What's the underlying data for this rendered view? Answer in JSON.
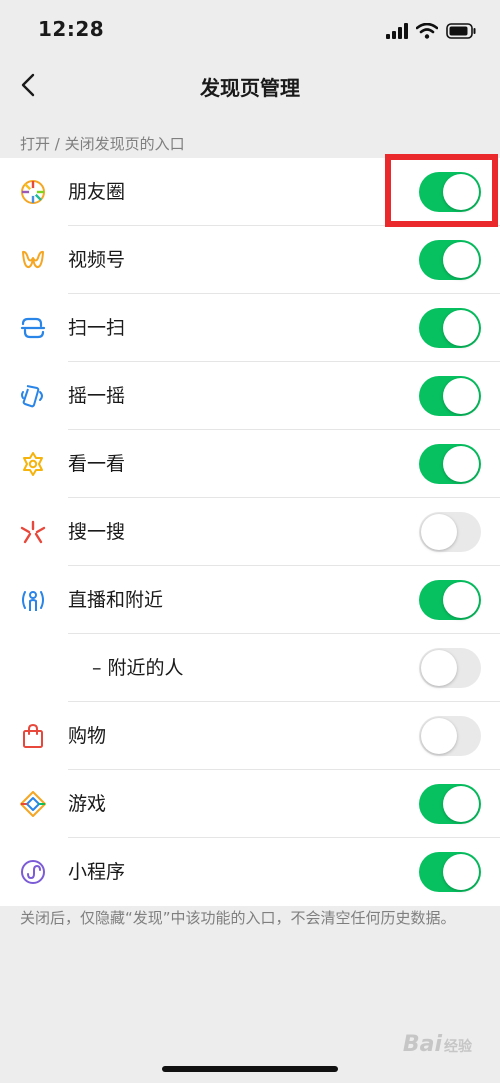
{
  "status_bar": {
    "time": "12:28"
  },
  "nav": {
    "title": "发现页管理"
  },
  "section_header": "打开 / 关闭发现页的入口",
  "items": [
    {
      "label": "朋友圈",
      "enabled": true,
      "icon": "moments-icon"
    },
    {
      "label": "视频号",
      "enabled": true,
      "icon": "channels-icon"
    },
    {
      "label": "扫一扫",
      "enabled": true,
      "icon": "scan-icon"
    },
    {
      "label": "摇一摇",
      "enabled": true,
      "icon": "shake-icon"
    },
    {
      "label": "看一看",
      "enabled": true,
      "icon": "top-stories-icon"
    },
    {
      "label": "搜一搜",
      "enabled": false,
      "icon": "search-icon"
    },
    {
      "label": "直播和附近",
      "enabled": true,
      "icon": "live-nearby-icon"
    },
    {
      "label": "– 附近的人",
      "enabled": false,
      "icon": ""
    },
    {
      "label": "购物",
      "enabled": false,
      "icon": "shopping-bag-icon"
    },
    {
      "label": "游戏",
      "enabled": true,
      "icon": "games-icon"
    },
    {
      "label": "小程序",
      "enabled": true,
      "icon": "mini-programs-icon"
    }
  ],
  "footer_note": "关闭后，仅隐藏“发现”中该功能的入口，不会清空任何历史数据。",
  "watermark": {
    "brand": "Bai",
    "sub": "经验"
  },
  "colors": {
    "switch_on": "#07c160",
    "switch_off": "#e9e9ea",
    "highlight": "#e9292b",
    "background": "#ededed"
  }
}
